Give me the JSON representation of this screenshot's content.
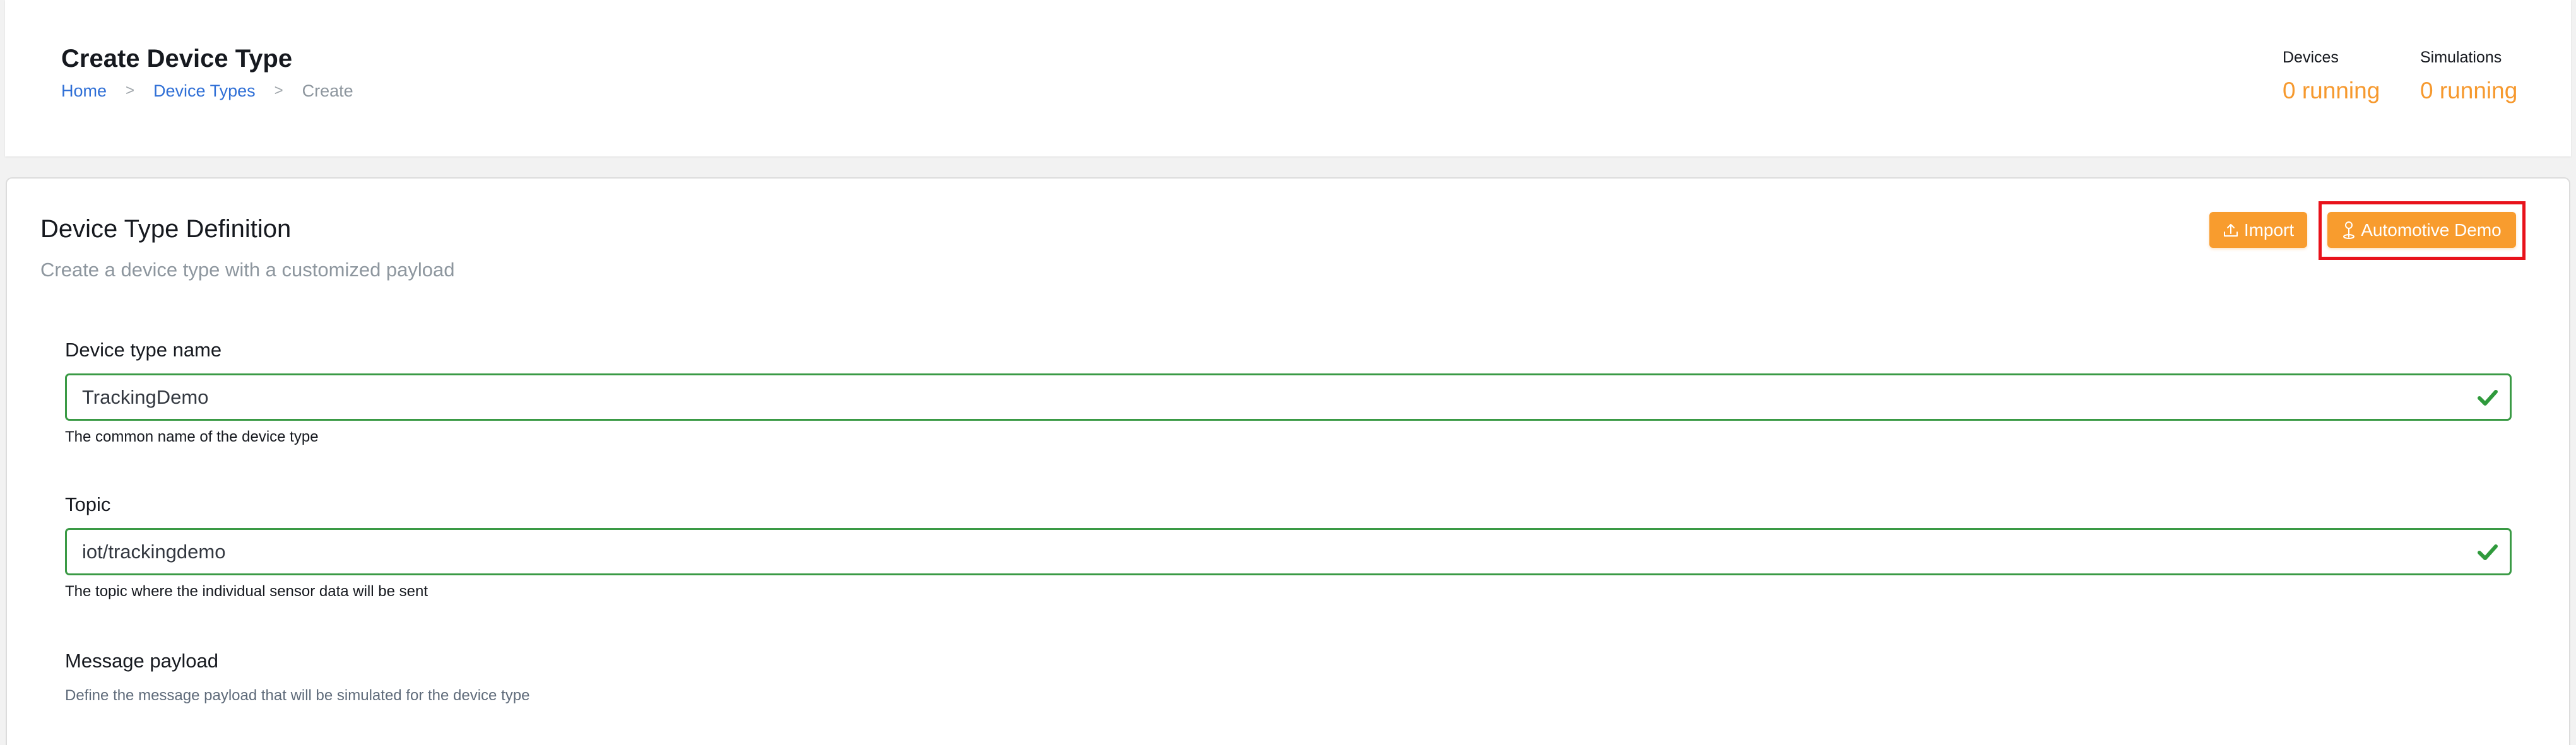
{
  "header": {
    "title": "Create Device Type",
    "breadcrumb": [
      {
        "label": "Home"
      },
      {
        "label": "Device Types"
      },
      {
        "label": "Create"
      }
    ],
    "breadcrumb_separator": ">",
    "stats": [
      {
        "label": "Devices",
        "value": "0 running"
      },
      {
        "label": "Simulations",
        "value": "0 running"
      }
    ]
  },
  "definition": {
    "title": "Device Type Definition",
    "subtitle": "Create a device type with a customized payload",
    "buttons": {
      "import": {
        "label": "Import",
        "icon": "upload-icon"
      },
      "automotive_demo": {
        "label": "Automotive Demo",
        "icon": "map-pin-icon"
      }
    },
    "fields": {
      "device_type_name": {
        "label": "Device type name",
        "value": "TrackingDemo",
        "help": "The common name of the device type",
        "status": "valid"
      },
      "topic": {
        "label": "Topic",
        "value": "iot/trackingdemo",
        "help": "The topic where the individual sensor data will be sent",
        "status": "valid"
      }
    },
    "payload": {
      "title": "Message payload",
      "description": "Define the message payload that will be simulated for the device type"
    }
  },
  "colors": {
    "accent": "#f89c2e",
    "valid": "#3a9a45",
    "link": "#2f6fd6",
    "highlight": "#e8121b"
  }
}
